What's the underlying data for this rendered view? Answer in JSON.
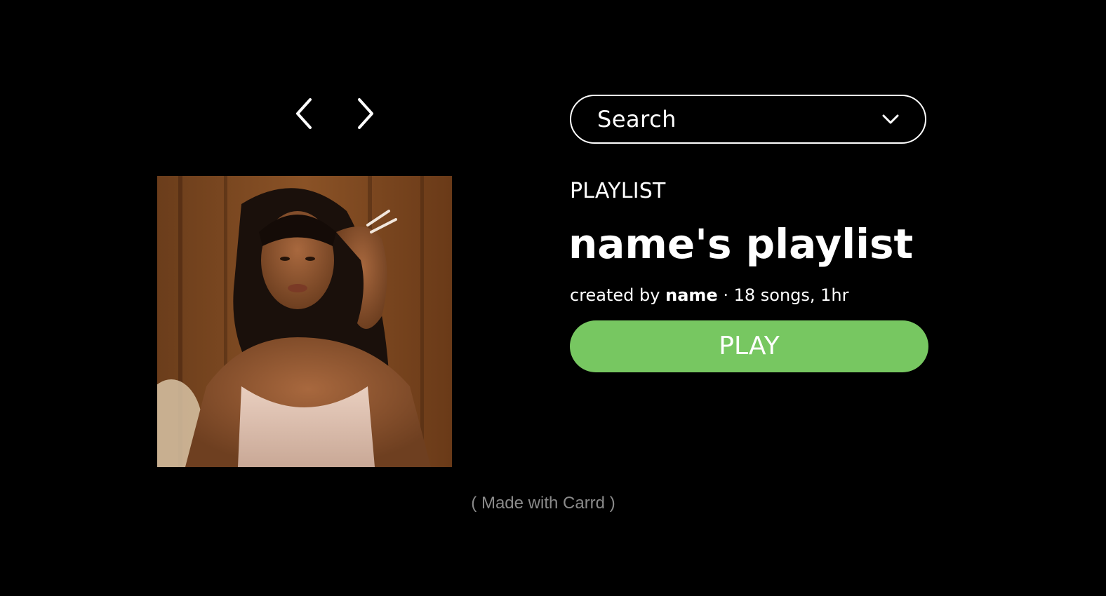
{
  "nav": {
    "prev_icon": "chevron-left-icon",
    "next_icon": "chevron-right-icon"
  },
  "search": {
    "label": "Search",
    "icon": "chevron-down-icon"
  },
  "playlist": {
    "kicker": "PLAYLIST",
    "title": "name's playlist",
    "meta_prefix": "created by",
    "creator": "name",
    "meta_suffix": "· 18 songs, 1hr",
    "play_label": "PLAY",
    "cover_alt": "playlist cover photo"
  },
  "footer": {
    "credit": "( Made with Carrd )"
  },
  "colors": {
    "background": "#000000",
    "play_button": "#77c761",
    "text": "#ffffff",
    "credit": "#8a8a8a"
  }
}
